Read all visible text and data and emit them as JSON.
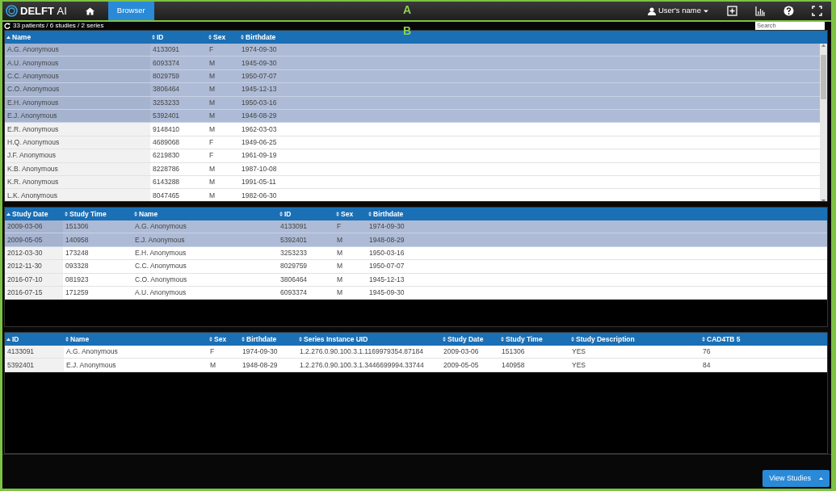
{
  "annotations": [
    {
      "label": "A"
    },
    {
      "label": "B"
    }
  ],
  "navbar": {
    "brand": {
      "name": "DELFT",
      "suffix": "AI"
    },
    "tabs": [
      {
        "kind": "home",
        "selected": false
      },
      {
        "kind": "text",
        "label": "Browser",
        "selected": true
      }
    ],
    "user": "User's name"
  },
  "status": "33 patients / 6 studies / 2 series",
  "search": {
    "placeholder": "Search"
  },
  "tables": [
    {
      "columns": [
        {
          "label": "Name",
          "sorted": true
        },
        {
          "label": "ID",
          "sorted": false
        },
        {
          "label": "Sex",
          "sorted": false
        },
        {
          "label": "Birthdate",
          "sorted": false
        }
      ],
      "rows": [
        {
          "cells": [
            "A.G. Anonymous",
            "4133091",
            "F",
            "1974-09-30"
          ],
          "selected": true
        },
        {
          "cells": [
            "A.U. Anonymous",
            "6093374",
            "M",
            "1945-09-30"
          ],
          "selected": true
        },
        {
          "cells": [
            "C.C. Anonymous",
            "8029759",
            "M",
            "1950-07-07"
          ],
          "selected": true
        },
        {
          "cells": [
            "C.O. Anonymous",
            "3806464",
            "M",
            "1945-12-13"
          ],
          "selected": true
        },
        {
          "cells": [
            "E.H. Anonymous",
            "3253233",
            "M",
            "1950-03-16"
          ],
          "selected": true
        },
        {
          "cells": [
            "E.J. Anonymous",
            "5392401",
            "M",
            "1948-08-29"
          ],
          "selected": true
        },
        {
          "cells": [
            "E.R. Anonymous",
            "9148410",
            "M",
            "1962-03-03"
          ],
          "selected": false
        },
        {
          "cells": [
            "H.Q. Anonymous",
            "4689068",
            "F",
            "1949-06-25"
          ],
          "selected": false
        },
        {
          "cells": [
            "J.F. Anonymous",
            "6219830",
            "F",
            "1961-09-19"
          ],
          "selected": false
        },
        {
          "cells": [
            "K.B. Anonymous",
            "8228786",
            "M",
            "1987-10-08"
          ],
          "selected": false
        },
        {
          "cells": [
            "K.R. Anonymous",
            "6143288",
            "M",
            "1991-05-11"
          ],
          "selected": false
        },
        {
          "cells": [
            "L.K. Anonymous",
            "8047465",
            "M",
            "1982-06-30"
          ],
          "selected": false
        }
      ]
    },
    {
      "columns": [
        {
          "label": "Study Date",
          "sorted": true
        },
        {
          "label": "Study Time",
          "sorted": false
        },
        {
          "label": "Name",
          "sorted": false
        },
        {
          "label": "ID",
          "sorted": false
        },
        {
          "label": "Sex",
          "sorted": false
        },
        {
          "label": "Birthdate",
          "sorted": false
        }
      ],
      "rows": [
        {
          "cells": [
            "2009-03-06",
            "151306",
            "A.G. Anonymous",
            "4133091",
            "F",
            "1974-09-30"
          ],
          "selected": true
        },
        {
          "cells": [
            "2009-05-05",
            "140958",
            "E.J. Anonymous",
            "5392401",
            "M",
            "1948-08-29"
          ],
          "selected": true
        },
        {
          "cells": [
            "2012-03-30",
            "173248",
            "E.H. Anonymous",
            "3253233",
            "M",
            "1950-03-16"
          ],
          "selected": false
        },
        {
          "cells": [
            "2012-11-30",
            "093328",
            "C.C. Anonymous",
            "8029759",
            "M",
            "1950-07-07"
          ],
          "selected": false
        },
        {
          "cells": [
            "2016-07-10",
            "081923",
            "C.O. Anonymous",
            "3806464",
            "M",
            "1945-12-13"
          ],
          "selected": false
        },
        {
          "cells": [
            "2016-07-15",
            "171259",
            "A.U. Anonymous",
            "6093374",
            "M",
            "1945-09-30"
          ],
          "selected": false
        }
      ]
    },
    {
      "columns": [
        {
          "label": "ID",
          "sorted": true
        },
        {
          "label": "Name",
          "sorted": false
        },
        {
          "label": "Sex",
          "sorted": false
        },
        {
          "label": "Birthdate",
          "sorted": false
        },
        {
          "label": "Series Instance UID",
          "sorted": false
        },
        {
          "label": "Study Date",
          "sorted": false
        },
        {
          "label": "Study Time",
          "sorted": false
        },
        {
          "label": "Study Description",
          "sorted": false
        },
        {
          "label": "CAD4TB 5",
          "sorted": false
        }
      ],
      "rows": [
        {
          "cells": [
            "4133091",
            "A.G. Anonymous",
            "F",
            "1974-09-30",
            "1.2.276.0.90.100.3.1.1169979354.87184",
            "2009-03-06",
            "151306",
            "YES",
            "76"
          ],
          "selected": false
        },
        {
          "cells": [
            "5392401",
            "E.J. Anonymous",
            "M",
            "1948-08-29",
            "1.2.276.0.90.100.3.1.3446699994.33744",
            "2009-05-05",
            "140958",
            "YES",
            "84"
          ],
          "selected": false
        }
      ]
    }
  ],
  "footer": {
    "button": "View Studies"
  }
}
